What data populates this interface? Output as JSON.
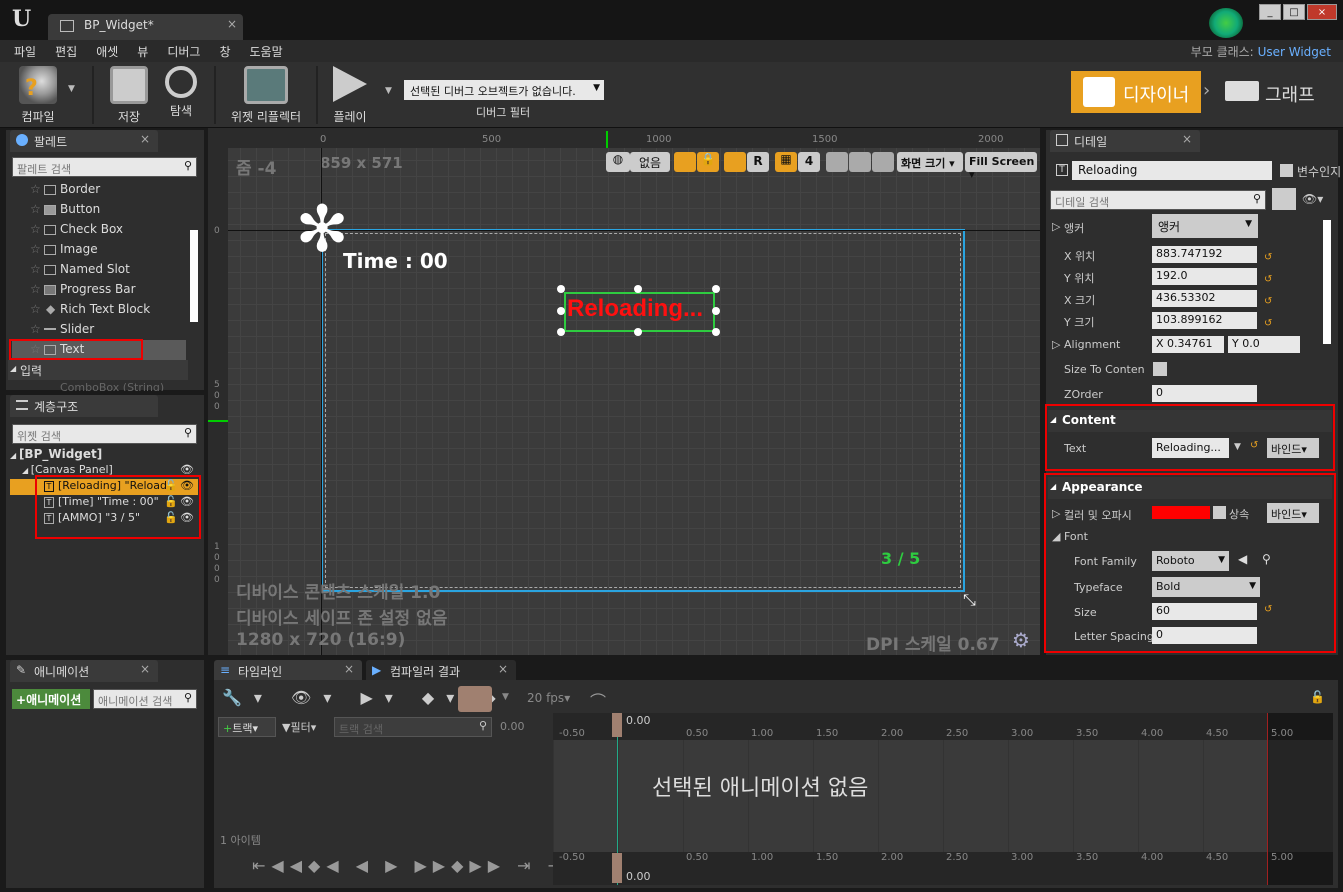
{
  "window": {
    "tab_title": "BP_Widget*",
    "parent_class_label": "부모 클래스:",
    "parent_class_value": "User Widget"
  },
  "menu": [
    "파일",
    "편집",
    "애셋",
    "뷰",
    "디버그",
    "창",
    "도움말"
  ],
  "toolbar": {
    "compile": "컴파일",
    "save": "저장",
    "browse": "탐색",
    "reflector": "위젯 리플렉터",
    "play": "플레이",
    "debug_filter_value": "선택된 디버그 오브젝트가 없습니다.",
    "debug_filter_label": "디버그 필터",
    "designer": "디자이너",
    "graph": "그래프"
  },
  "palette": {
    "tab": "팔레트",
    "search_placeholder": "팔레트 검색",
    "items": [
      "Border",
      "Button",
      "Check Box",
      "Image",
      "Named Slot",
      "Progress Bar",
      "Rich Text Block",
      "Slider",
      "Text"
    ],
    "section": "입력",
    "cut_item": "ComboBox (String)"
  },
  "hierarchy": {
    "tab": "계층구조",
    "search_placeholder": "위젯 검색",
    "root": "[BP_Widget]",
    "canvas": "[Canvas Panel]",
    "rows": [
      "[Reloading] \"Reload",
      "[Time] \"Time : 00\"",
      "[AMMO] \"3 / 5\""
    ]
  },
  "canvas": {
    "zoom": "줌 -4",
    "size": "859 x 571",
    "ruler_top": [
      "0",
      "500",
      "1000",
      "1500",
      "2000"
    ],
    "ruler_left": [
      "0",
      "500",
      "1000"
    ],
    "none_btn": "없음",
    "snap_value": "4",
    "screen_size": "화면 크기",
    "fill_mode": "Fill Screen",
    "time_text": "Time : 00",
    "reload_text": "Reloading...",
    "ammo_text": "3 / 5",
    "device_scale": "디바이스 콘텐츠 스케일 1.0",
    "safe_zone": "디바이스 세이프 존 설정 없음",
    "resolution": "1280 x 720 (16:9)",
    "dpi": "DPI 스케일 0.67"
  },
  "details": {
    "tab": "디테일",
    "name": "Reloading",
    "is_variable": "변수인지",
    "search_placeholder": "디테일 검색",
    "anchor_label": "앵커",
    "anchor_value": "앵커",
    "x_pos_label": "X 위치",
    "x_pos": "883.747192",
    "y_pos_label": "Y 위치",
    "y_pos": "192.0",
    "x_size_label": "X 크기",
    "x_size": "436.53302",
    "y_size_label": "Y 크기",
    "y_size": "103.899162",
    "alignment_label": "Alignment",
    "align_x": "0.34761",
    "align_y": "0.0",
    "size_to_content": "Size To Content",
    "zorder_label": "ZOrder",
    "zorder": "0",
    "content_hdr": "Content",
    "text_label": "Text",
    "text_value": "Reloading...",
    "bind": "바인드",
    "appearance_hdr": "Appearance",
    "color_label": "컬러 및 오파시",
    "inherit": "상속",
    "font_label": "Font",
    "font_family_label": "Font Family",
    "font_family": "Roboto",
    "typeface_label": "Typeface",
    "typeface": "Bold",
    "size_label": "Size",
    "size": "60",
    "letter_spacing_label": "Letter Spacing",
    "letter_spacing": "0",
    "text_color": "#ff0000"
  },
  "bottom": {
    "anim_tab": "애니메이션",
    "timeline_tab": "타임라인",
    "compiler_tab": "컴파일러 결과",
    "add_anim": "애니메이션",
    "anim_search": "애니메이션 검색",
    "fps": "20 fps",
    "track_btn": "트랙",
    "filter_btn": "필터",
    "track_search": "트랙 검색",
    "time_start": "0.00",
    "item_count": "1 아이템",
    "no_anim": "선택된 애니메이션 없음",
    "ticks": [
      "-0.50",
      "0.00",
      "0.50",
      "1.00",
      "1.50",
      "2.00",
      "2.50",
      "3.00",
      "3.50",
      "4.00",
      "4.50",
      "5.00"
    ]
  }
}
